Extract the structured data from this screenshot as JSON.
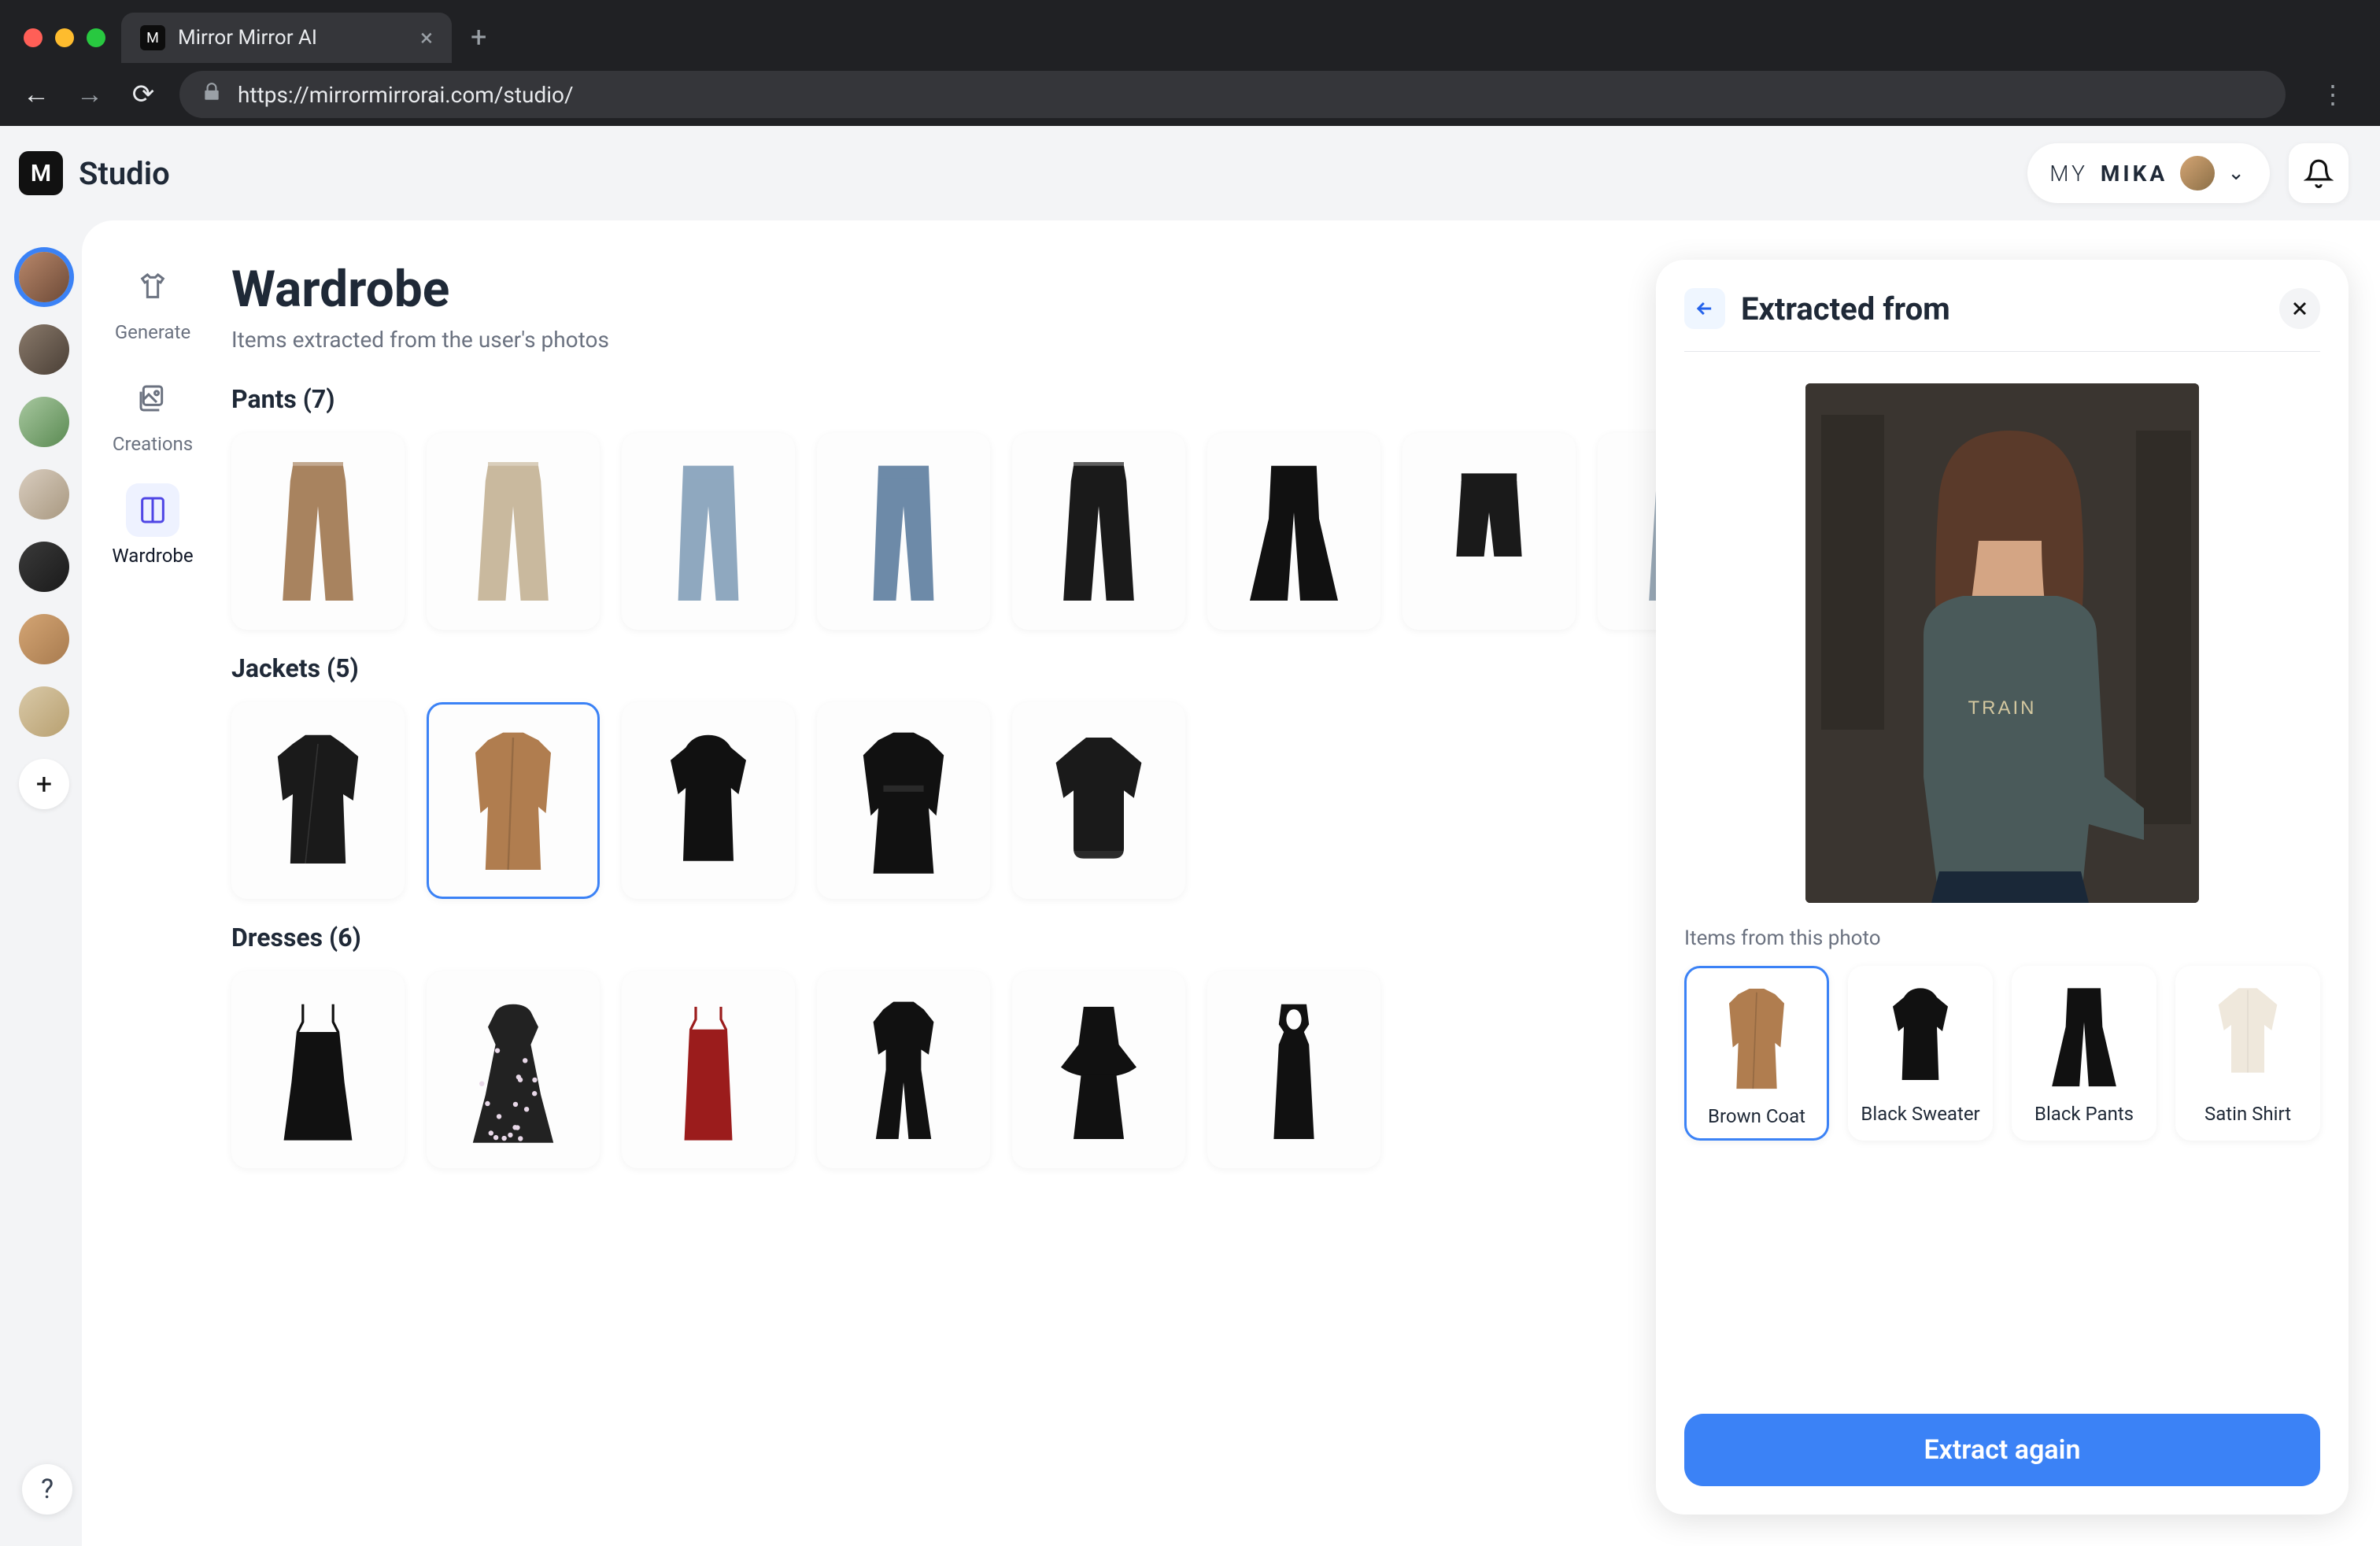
{
  "browser": {
    "tab_title": "Mirror Mirror AI",
    "url": "https://mirrormirrorai.com/studio/"
  },
  "header": {
    "app_title": "Studio",
    "profile_prefix": "MY",
    "profile_name": "MIKA"
  },
  "rail": {
    "avatars": [
      {
        "active": true,
        "bg": "linear-gradient(135deg,#b8876a,#6d4a37)"
      },
      {
        "active": false,
        "bg": "linear-gradient(135deg,#8a7a6b,#4a3f36)"
      },
      {
        "active": false,
        "bg": "linear-gradient(135deg,#a8c8a0,#5a8a52)"
      },
      {
        "active": false,
        "bg": "linear-gradient(135deg,#d9cdbf,#a89880)"
      },
      {
        "active": false,
        "bg": "linear-gradient(135deg,#3a3a3a,#1a1a1a)"
      },
      {
        "active": false,
        "bg": "linear-gradient(135deg,#d4a574,#a87b4f)"
      },
      {
        "active": false,
        "bg": "linear-gradient(135deg,#d9c9a8,#b8a070)"
      }
    ]
  },
  "tools": {
    "generate": "Generate",
    "creations": "Creations",
    "wardrobe": "Wardrobe"
  },
  "page": {
    "title": "Wardrobe",
    "subtitle": "Items extracted from the user's photos"
  },
  "sections": {
    "pants": {
      "title": "Pants (7)",
      "count": 7,
      "items": [
        {
          "name": "brown-wide-pants",
          "color": "#a8835f",
          "shape": "pants-wide"
        },
        {
          "name": "beige-wide-pants",
          "color": "#c9b99e",
          "shape": "pants-wide"
        },
        {
          "name": "light-jeans-raw",
          "color": "#8fa8bf",
          "shape": "jeans"
        },
        {
          "name": "blue-jeans",
          "color": "#6d8aa8",
          "shape": "jeans"
        },
        {
          "name": "black-trousers",
          "color": "#1a1a1a",
          "shape": "pants-wide"
        },
        {
          "name": "black-palazzo",
          "color": "#111",
          "shape": "pants-flare"
        },
        {
          "name": "black-leather-shorts",
          "color": "#1a1a1a",
          "shape": "shorts"
        },
        {
          "name": "grey-wide-jeans",
          "color": "#9aaab8",
          "shape": "pants-wide"
        }
      ]
    },
    "jackets": {
      "title": "Jackets (5)",
      "count": 5,
      "items": [
        {
          "name": "black-biker-jacket",
          "color": "#1a1a1a",
          "shape": "jacket-biker"
        },
        {
          "name": "brown-coat",
          "color": "#b07d4f",
          "shape": "coat",
          "selected": true
        },
        {
          "name": "black-sweater-dress",
          "color": "#111",
          "shape": "sweater"
        },
        {
          "name": "black-trench",
          "color": "#111",
          "shape": "trench"
        },
        {
          "name": "black-bomber",
          "color": "#1a1a1a",
          "shape": "bomber"
        }
      ]
    },
    "dresses": {
      "title": "Dresses (6)",
      "count": 6,
      "items": [
        {
          "name": "black-strap-dress",
          "color": "#111",
          "shape": "dress-strap"
        },
        {
          "name": "floral-midi-dress",
          "color": "#222",
          "shape": "dress-floral"
        },
        {
          "name": "red-slip-dress",
          "color": "#9b1c1c",
          "shape": "dress-slip"
        },
        {
          "name": "black-jumpsuit",
          "color": "#111",
          "shape": "jumpsuit"
        },
        {
          "name": "black-peplum-dress",
          "color": "#111",
          "shape": "dress-peplum"
        },
        {
          "name": "black-cutout-dress",
          "color": "#111",
          "shape": "dress-cutout"
        }
      ]
    }
  },
  "panel": {
    "title": "Extracted from",
    "items_label": "Items from this photo",
    "button": "Extract again",
    "extracted": [
      {
        "label": "Brown Coat",
        "color": "#b07d4f",
        "shape": "coat",
        "selected": true
      },
      {
        "label": "Black Sweater",
        "color": "#111",
        "shape": "sweater",
        "selected": false
      },
      {
        "label": "Black Pants",
        "color": "#111",
        "shape": "pants-flare",
        "selected": false
      },
      {
        "label": "Satin Shirt",
        "color": "#efe8dc",
        "shape": "shirt",
        "selected": false
      }
    ]
  }
}
